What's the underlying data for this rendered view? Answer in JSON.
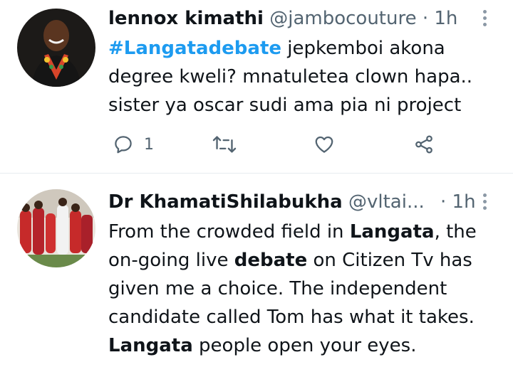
{
  "tweets": [
    {
      "name": "lennox kimathi",
      "handle": "@jambocouture",
      "separator": "·",
      "time": "1h",
      "hashtag": "#Langatadebate",
      "line1_rest": " jepkemboi  akona",
      "line2": "degree kweli? mnatuletea clown hapa..",
      "line3": "sister ya oscar sudi ama pia ni project",
      "reply_count": "1",
      "icons": [
        "reply-icon",
        "retweet-icon",
        "like-icon",
        "share-icon"
      ]
    },
    {
      "name": "Dr KhamatiShilabukha",
      "handle": "@vltai...",
      "separator": "·",
      "time": "1h",
      "l1_a": "From the crowded field in ",
      "l1_b": "Langata",
      "l1_c": ", the",
      "l2_a": "on-going live ",
      "l2_b": "debate",
      "l2_c": " on Citizen Tv has",
      "l3": "given me a choice. The independent",
      "l4": "candidate called Tom has what it takes.",
      "l5_a": "Langata",
      "l5_b": " people open your eyes."
    }
  ],
  "colors": {
    "link": "#1d9bf0",
    "secondary": "#536471",
    "text": "#0f1419",
    "divider": "#e6ecf0"
  }
}
